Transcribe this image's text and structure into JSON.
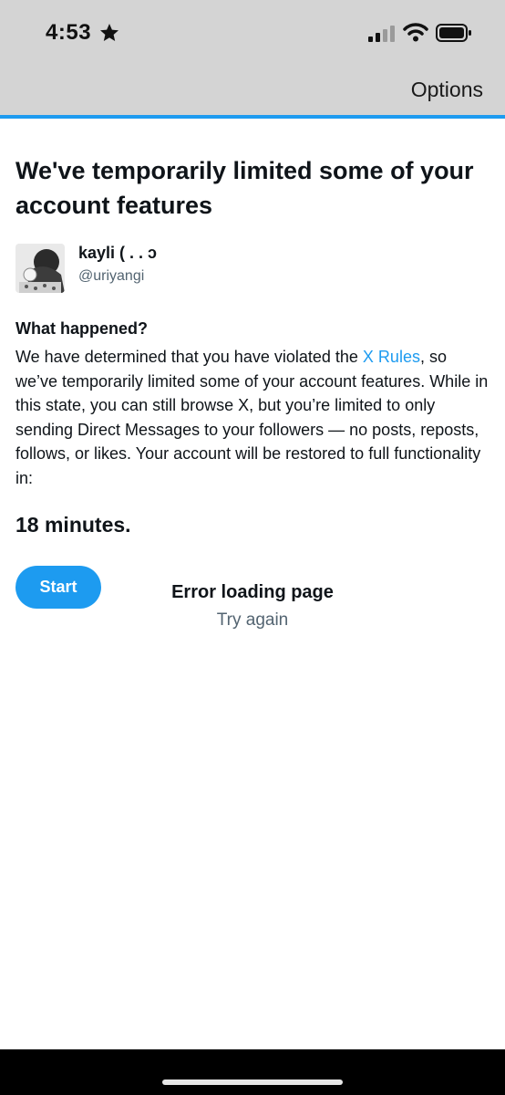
{
  "status_bar": {
    "time": "4:53",
    "icons": [
      "star-icon",
      "cellular-signal-icon",
      "wifi-icon",
      "battery-icon"
    ]
  },
  "header": {
    "options_label": "Options",
    "accent_color": "#1d9bf0"
  },
  "notice": {
    "title": "We've temporarily limited some of your account features",
    "user": {
      "name": "kayli ( . . ɔ",
      "handle": "@uriyangi"
    },
    "section_heading": "What happened?",
    "body_before_link": "We have determined that you have violated the ",
    "rules_link_label": "X Rules",
    "body_after_link": ", so we’ve temporarily limited some of your account features. While in this state, you can still browse X, but you’re limited to only sending Direct Messages to your followers — no posts, reposts, follows, or likes. Your account will be restored to full functionality in:",
    "countdown": "18 minutes.",
    "start_label": "Start"
  },
  "error": {
    "title": "Error loading page",
    "retry_label": "Try again"
  },
  "colors": {
    "brand_blue": "#1d9bf0",
    "header_gray": "#d4d4d4",
    "secondary_text": "#536471"
  }
}
